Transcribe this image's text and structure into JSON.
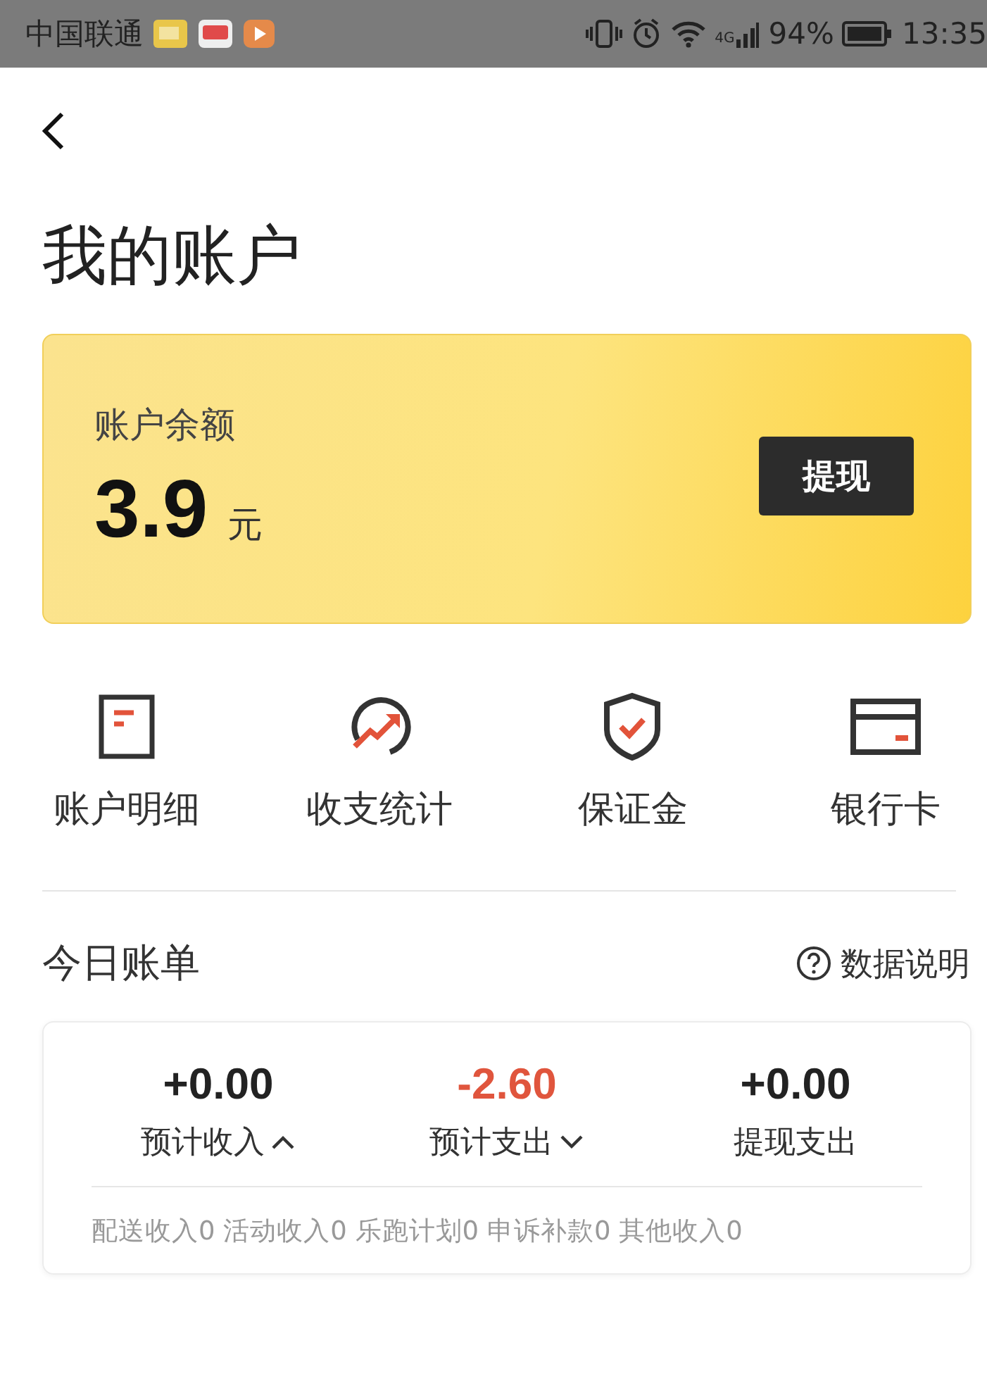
{
  "status_bar": {
    "carrier": "中国联通",
    "battery": "94%",
    "signal_label": "4G",
    "time": "13:35"
  },
  "page": {
    "title": "我的账户"
  },
  "balance_card": {
    "label": "账户余额",
    "amount": "3.9",
    "unit": "元",
    "button": "提现"
  },
  "shortcuts": [
    {
      "kind": "ledger",
      "label": "账户明细"
    },
    {
      "kind": "stats",
      "label": "收支统计"
    },
    {
      "kind": "deposit",
      "label": "保证金"
    },
    {
      "kind": "card",
      "label": "银行卡"
    }
  ],
  "today": {
    "title": "今日账单",
    "help": "数据说明",
    "stats": [
      {
        "kind": "toggle",
        "value": "+0.00",
        "label": "预计收入",
        "negative": false,
        "expanded": true
      },
      {
        "kind": "toggle",
        "value": "-2.60",
        "label": "预计支出",
        "negative": true,
        "expanded": false
      },
      {
        "kind": "plain",
        "value": "+0.00",
        "label": "提现支出",
        "negative": false
      }
    ],
    "breakdown": "配送收入0 活动收入0 乐跑计划0 申诉补款0 其他收入0"
  }
}
